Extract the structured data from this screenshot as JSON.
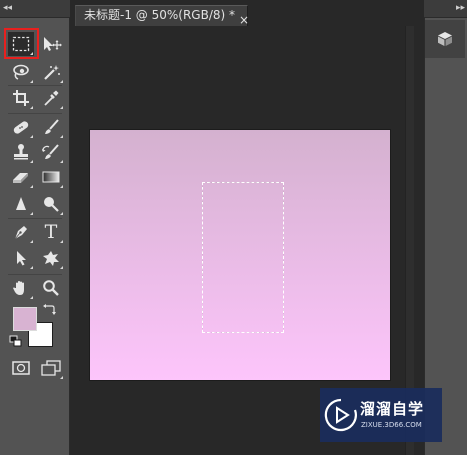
{
  "document": {
    "tab_title": "未标题-1 @ 50%(RGB/8) *",
    "close_glyph": "×",
    "canvas_gradient": {
      "top": "#d4b1cf",
      "bottom": "#fdc5fb"
    }
  },
  "panels": {
    "collapse_left_glyph": "◂◂",
    "collapse_right_glyph": "▸▸"
  },
  "toolbar": {
    "active_tool": "rectangular-marquee-tool",
    "tools": [
      "rectangular-marquee-tool",
      "move-tool",
      "lasso-tool",
      "magic-wand-tool",
      "crop-tool",
      "eyedropper-tool",
      "spot-healing-brush-tool",
      "brush-tool",
      "clone-stamp-tool",
      "history-brush-tool",
      "eraser-tool",
      "gradient-tool",
      "blur-tool",
      "dodge-tool",
      "pen-tool",
      "type-tool",
      "path-selection-tool",
      "custom-shape-tool",
      "hand-tool",
      "zoom-tool"
    ],
    "type_tool_glyph": "T",
    "foreground_color": "#d8b3d2",
    "background_color": "#ffffff",
    "highlight_color": "#e8201e"
  },
  "watermark": {
    "title": "溜溜自学",
    "url": "ZIXUE.3D66.COM"
  }
}
